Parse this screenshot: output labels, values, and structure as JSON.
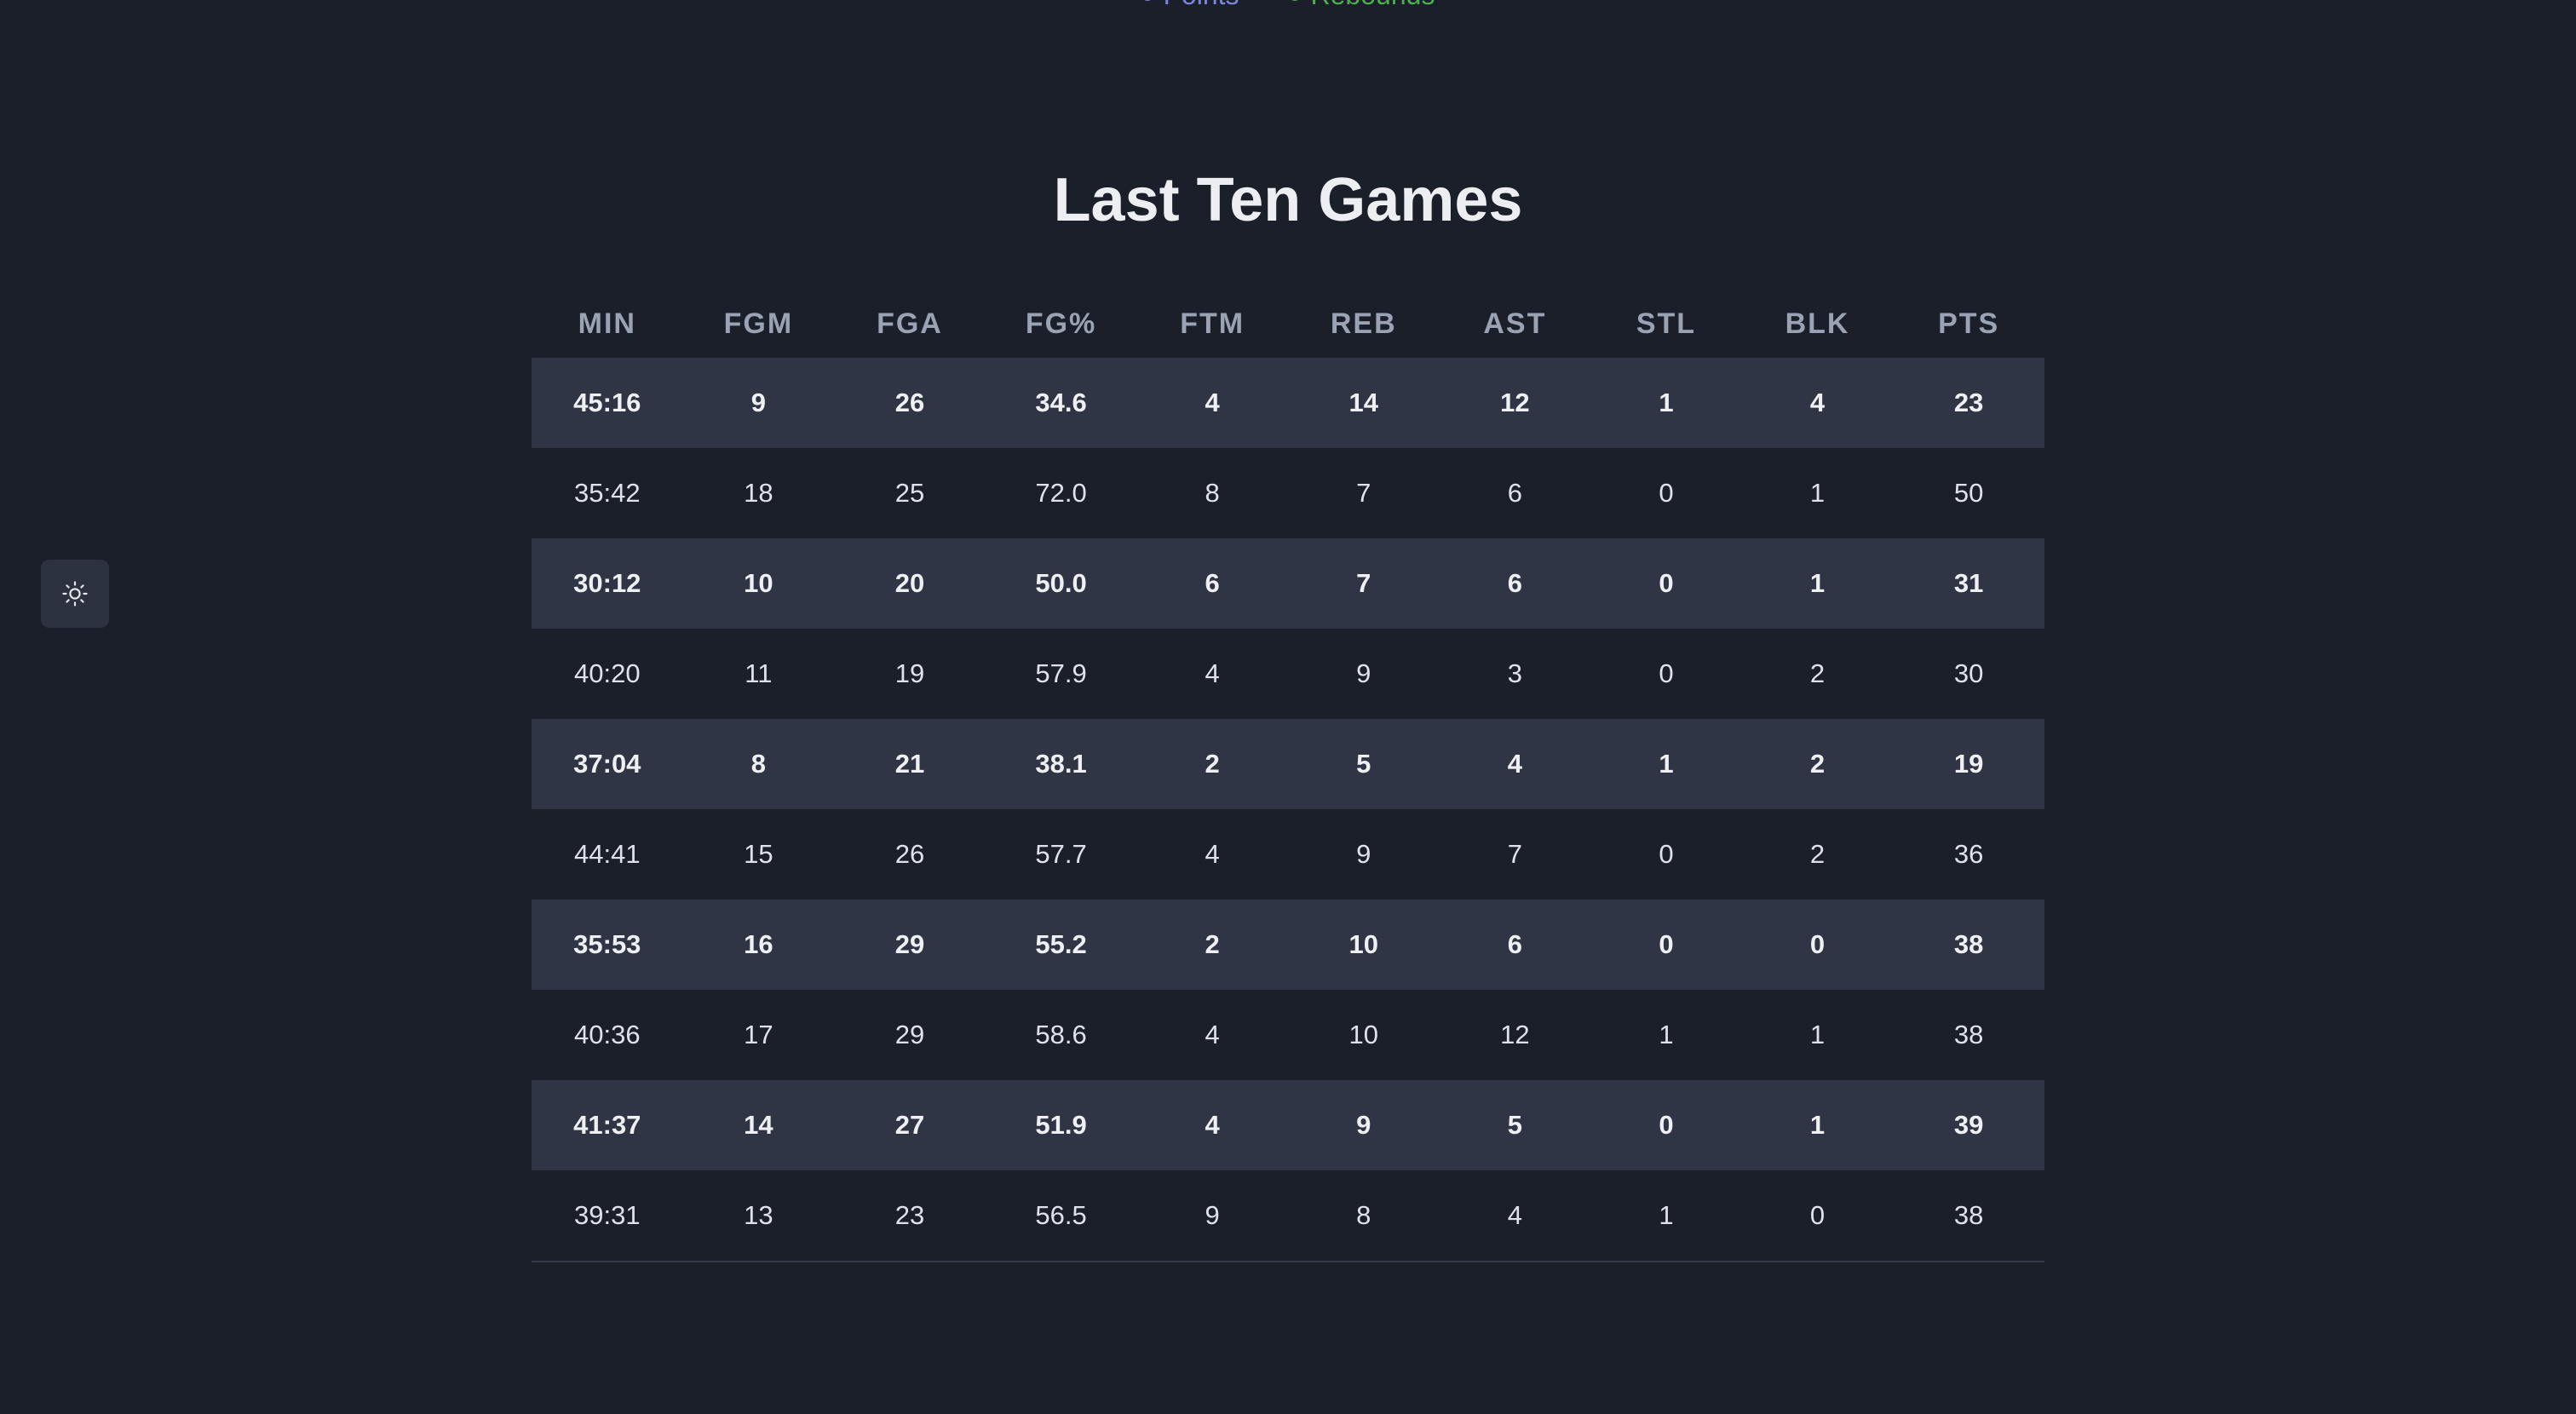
{
  "legend": {
    "items": [
      {
        "label": "Points",
        "color": "#7c86e0"
      },
      {
        "label": "Rebounds",
        "color": "#4caf50"
      }
    ]
  },
  "theme_toggle": {
    "icon": "sun-icon"
  },
  "section": {
    "title": "Last Ten Games"
  },
  "table": {
    "columns": [
      "MIN",
      "FGM",
      "FGA",
      "FG%",
      "FTM",
      "REB",
      "AST",
      "STL",
      "BLK",
      "PTS"
    ],
    "rows": [
      [
        "45:16",
        "9",
        "26",
        "34.6",
        "4",
        "14",
        "12",
        "1",
        "4",
        "23"
      ],
      [
        "35:42",
        "18",
        "25",
        "72.0",
        "8",
        "7",
        "6",
        "0",
        "1",
        "50"
      ],
      [
        "30:12",
        "10",
        "20",
        "50.0",
        "6",
        "7",
        "6",
        "0",
        "1",
        "31"
      ],
      [
        "40:20",
        "11",
        "19",
        "57.9",
        "4",
        "9",
        "3",
        "0",
        "2",
        "30"
      ],
      [
        "37:04",
        "8",
        "21",
        "38.1",
        "2",
        "5",
        "4",
        "1",
        "2",
        "19"
      ],
      [
        "44:41",
        "15",
        "26",
        "57.7",
        "4",
        "9",
        "7",
        "0",
        "2",
        "36"
      ],
      [
        "35:53",
        "16",
        "29",
        "55.2",
        "2",
        "10",
        "6",
        "0",
        "0",
        "38"
      ],
      [
        "40:36",
        "17",
        "29",
        "58.6",
        "4",
        "10",
        "12",
        "1",
        "1",
        "38"
      ],
      [
        "41:37",
        "14",
        "27",
        "51.9",
        "4",
        "9",
        "5",
        "0",
        "1",
        "39"
      ],
      [
        "39:31",
        "13",
        "23",
        "56.5",
        "9",
        "8",
        "4",
        "1",
        "0",
        "38"
      ]
    ]
  }
}
